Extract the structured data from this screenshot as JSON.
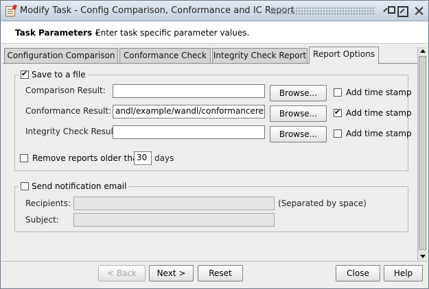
{
  "window": {
    "title": "Modify Task - Config Comparison, Conformance and IC Report"
  },
  "header": {
    "title": "Task Parameters -",
    "description": "Enter task specific parameter values."
  },
  "tabs": [
    {
      "label": "Configuration Comparison",
      "active": false
    },
    {
      "label": "Conformance Check",
      "active": false
    },
    {
      "label": "Integrity Check Report",
      "active": false
    },
    {
      "label": "Report Options",
      "active": true
    }
  ],
  "save_group": {
    "label": "Save to a file",
    "checked": true,
    "rows": [
      {
        "label": "Comparison Result:",
        "value": "",
        "browse_label": "Browse...",
        "timestamp_label": "Add time stamp",
        "timestamp_checked": false
      },
      {
        "label": "Conformance Result:",
        "value": "andl/example/wandl/conformanceresults",
        "browse_label": "Browse...",
        "timestamp_label": "Add time stamp",
        "timestamp_checked": true
      },
      {
        "label": "Integrity Check Result:",
        "value": "",
        "browse_label": "Browse...",
        "timestamp_label": "Add time stamp",
        "timestamp_checked": false
      }
    ],
    "remove_prefix": "Remove reports older than",
    "remove_checked": false,
    "remove_days": "30",
    "remove_suffix": "days"
  },
  "email_group": {
    "label": "Send notification email",
    "checked": false,
    "recipients_label": "Recipients:",
    "recipients_value": "",
    "recipients_hint": "(Separated by space)",
    "subject_label": "Subject:",
    "subject_value": ""
  },
  "footer": {
    "back_label": "< Back",
    "next_label": "Next >",
    "reset_label": "Reset",
    "close_label": "Close",
    "help_label": "Help"
  }
}
